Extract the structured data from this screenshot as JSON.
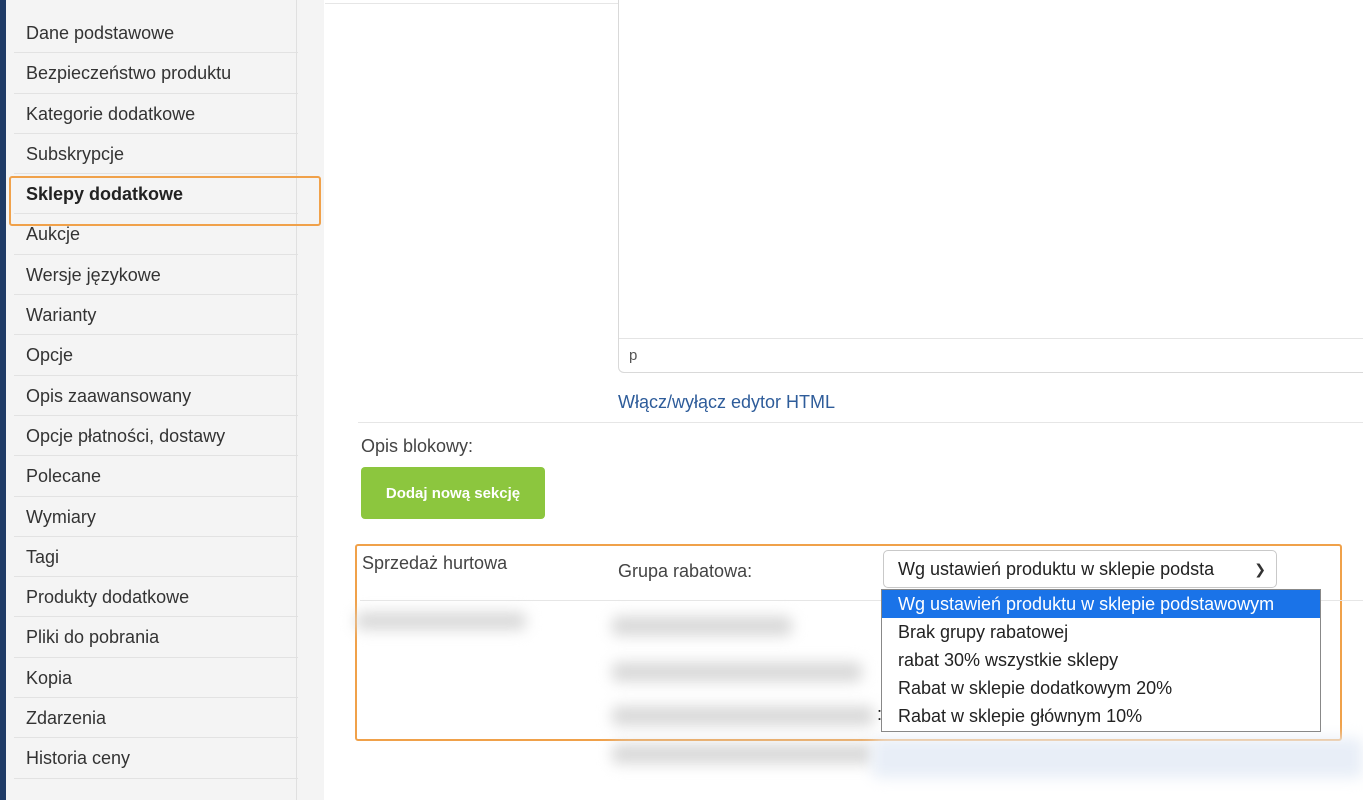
{
  "sidebar": {
    "items": [
      {
        "label": "Dane podstawowe"
      },
      {
        "label": "Bezpieczeństwo produktu"
      },
      {
        "label": "Kategorie dodatkowe"
      },
      {
        "label": "Subskrypcje"
      },
      {
        "label": "Sklepy dodatkowe",
        "active": true
      },
      {
        "label": "Aukcje"
      },
      {
        "label": "Wersje językowe"
      },
      {
        "label": "Warianty"
      },
      {
        "label": "Opcje"
      },
      {
        "label": "Opis zaawansowany"
      },
      {
        "label": "Opcje płatności, dostawy"
      },
      {
        "label": "Polecane"
      },
      {
        "label": "Wymiary"
      },
      {
        "label": "Tagi"
      },
      {
        "label": "Produkty dodatkowe"
      },
      {
        "label": "Pliki do pobrania"
      },
      {
        "label": "Kopia"
      },
      {
        "label": "Zdarzenia"
      },
      {
        "label": "Historia ceny"
      }
    ]
  },
  "editor": {
    "status_path": "p",
    "toggle_html_label": "Włącz/wyłącz edytor HTML"
  },
  "block_description": {
    "label": "Opis blokowy:",
    "add_section_button": "Dodaj nową sekcję"
  },
  "wholesale": {
    "section_label": "Sprzedaż hurtowa",
    "discount_group_label": "Grupa rabatowa:",
    "selected_value": "Wg ustawień produktu w sklepie podsta",
    "options": [
      "Wg ustawień produktu w sklepie podstawowym",
      "Brak grupy rabatowej",
      "rabat 30% wszystkie sklepy",
      "Rabat w sklepie dodatkowym 20%",
      "Rabat w sklepie głównym 10%"
    ],
    "selected_index": 0
  },
  "colors": {
    "highlight": "#f0a14a",
    "green_button": "#8cc63e",
    "link": "#2e5c9a",
    "option_selected": "#1a73e8"
  }
}
